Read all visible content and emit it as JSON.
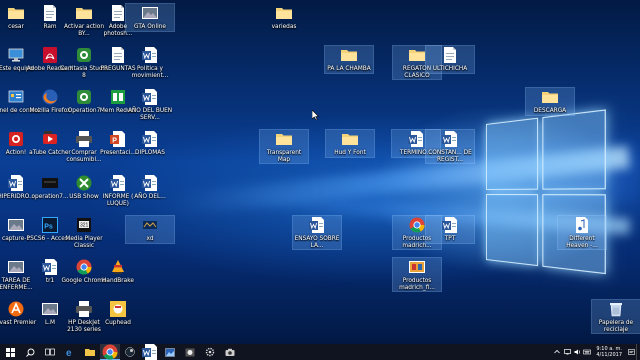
{
  "desktop": {
    "icons": [
      {
        "label": "cesar",
        "icon": "user-folder-icon",
        "kind": "folder"
      },
      {
        "label": "Ram",
        "icon": "document-icon",
        "kind": "doc"
      },
      {
        "label": "Activar action BY...",
        "icon": "folder-icon",
        "kind": "folder"
      },
      {
        "label": "Adobe photosh...",
        "icon": "photoshop-icon",
        "kind": "doc"
      },
      {
        "label": "GTA Online",
        "icon": "gta-icon",
        "kind": "image"
      },
      {
        "label": "variedas",
        "icon": "folder-icon",
        "kind": "folder"
      },
      {
        "label": "Este equipo",
        "icon": "computer-icon",
        "kind": "computer"
      },
      {
        "label": "Adobe Reader X",
        "icon": "pdf-icon",
        "kind": "pdf"
      },
      {
        "label": "Camtasia Studio 8",
        "icon": "camtasia-icon",
        "kind": "app"
      },
      {
        "label": "PREGUNTAS",
        "icon": "document-icon",
        "kind": "doc"
      },
      {
        "label": "Politica y movimient...",
        "icon": "word-icon",
        "kind": "word"
      },
      {
        "label": "PA LA CHAMBA",
        "icon": "folder-icon",
        "kind": "folder"
      },
      {
        "label": "REGATON CLASICO",
        "icon": "folder-icon",
        "kind": "folder"
      },
      {
        "label": "ULTICHICHA",
        "icon": "document-icon",
        "kind": "doc"
      },
      {
        "label": "Panel de control",
        "icon": "control-panel-icon",
        "kind": "control"
      },
      {
        "label": "Mozilla Firefox",
        "icon": "firefox-icon",
        "kind": "firefox"
      },
      {
        "label": "Operation7",
        "icon": "operation7-icon",
        "kind": "app"
      },
      {
        "label": "Mem Reduct",
        "icon": "mem-reduct-icon",
        "kind": "mem"
      },
      {
        "label": "AÑO DEL BUEN SERV...",
        "icon": "word-icon",
        "kind": "word"
      },
      {
        "label": "DESCARGA",
        "icon": "folder-icon",
        "kind": "folder"
      },
      {
        "label": "Action!",
        "icon": "action-icon",
        "kind": "action"
      },
      {
        "label": "aTube Catcher",
        "icon": "atube-icon",
        "kind": "atube"
      },
      {
        "label": "Comprar consumibl...",
        "icon": "printer-icon",
        "kind": "printer"
      },
      {
        "label": "Presentaci...",
        "icon": "powerpoint-icon",
        "kind": "ppt"
      },
      {
        "label": "DIPLOMAS",
        "icon": "word-icon",
        "kind": "word"
      },
      {
        "label": "Transparent Map",
        "icon": "folder-icon",
        "kind": "folder"
      },
      {
        "label": "Hud Y Font",
        "icon": "folder-icon",
        "kind": "folder"
      },
      {
        "label": "TERMINO...",
        "icon": "word-icon",
        "kind": "word"
      },
      {
        "label": "CONSTAN... DE REGIST...",
        "icon": "word-icon",
        "kind": "word"
      },
      {
        "label": "HIPERIDRO...",
        "icon": "word-icon",
        "kind": "word"
      },
      {
        "label": "operation7...",
        "icon": "operation7-file-icon",
        "kind": "dark"
      },
      {
        "label": "USB Show",
        "icon": "usb-show-icon",
        "kind": "usb"
      },
      {
        "label": "INFORME ( LUQUE)",
        "icon": "word-icon",
        "kind": "word"
      },
      {
        "label": "AÑO DEL...",
        "icon": "word-icon",
        "kind": "word"
      },
      {
        "label": "ENSAYO SOBRE LA...",
        "icon": "word-icon",
        "kind": "word"
      },
      {
        "label": "Productos madrich...",
        "icon": "chrome-file-icon",
        "kind": "chrome"
      },
      {
        "label": "TPT",
        "icon": "word-icon",
        "kind": "word"
      },
      {
        "label": "Different Heaven -...",
        "icon": "audio-file-icon",
        "kind": "audio"
      },
      {
        "label": "capture-1",
        "icon": "image-icon",
        "kind": "image"
      },
      {
        "label": "PSCS6 - Acces...",
        "icon": "photoshop-icon",
        "kind": "ps"
      },
      {
        "label": "Media Player Classic",
        "icon": "mpc-icon",
        "kind": "mpc"
      },
      {
        "label": "xd",
        "icon": "game-file-icon",
        "kind": "xd"
      },
      {
        "label": "TAREA DE ENFERME...",
        "icon": "image-icon",
        "kind": "image"
      },
      {
        "label": "tr1",
        "icon": "word-icon",
        "kind": "word"
      },
      {
        "label": "Google Chrome",
        "icon": "chrome-icon",
        "kind": "chrome"
      },
      {
        "label": "HandBrake",
        "icon": "handbrake-icon",
        "kind": "handbrake"
      },
      {
        "label": "Productos madrich_fi...",
        "icon": "image-icon",
        "kind": "image2"
      },
      {
        "label": "Avast Premier",
        "icon": "avast-icon",
        "kind": "avast"
      },
      {
        "label": "L.M",
        "icon": "image-icon",
        "kind": "image"
      },
      {
        "label": "HP DeskJet 2130 series",
        "icon": "printer-icon",
        "kind": "printer"
      },
      {
        "label": "Cuphead",
        "icon": "cuphead-icon",
        "kind": "cuphead"
      },
      {
        "label": "Papelera de reciclaje",
        "icon": "recycle-bin-icon",
        "kind": "bin"
      }
    ]
  },
  "taskbar": {
    "items": [
      {
        "icon": "windows-start-icon",
        "kind": "start"
      },
      {
        "icon": "search-icon",
        "kind": "search"
      },
      {
        "icon": "task-view-icon",
        "kind": "taskview"
      },
      {
        "icon": "edge-icon",
        "kind": "edge"
      },
      {
        "icon": "file-explorer-icon",
        "kind": "explorer"
      },
      {
        "icon": "chrome-icon",
        "kind": "chrome",
        "active": true
      },
      {
        "icon": "steam-icon",
        "kind": "steam"
      },
      {
        "icon": "word-icon",
        "kind": "word"
      },
      {
        "icon": "image-app-icon",
        "kind": "imgapp"
      },
      {
        "icon": "photos-icon",
        "kind": "photos"
      },
      {
        "icon": "gear-app-icon",
        "kind": "gear"
      },
      {
        "icon": "camera-app-icon",
        "kind": "cam"
      }
    ],
    "tray_icons": [
      "chevron-up-icon",
      "network-icon",
      "volume-icon",
      "keyboard-icon"
    ],
    "time": "9:10 a. m.",
    "date": "4/11/2017"
  }
}
